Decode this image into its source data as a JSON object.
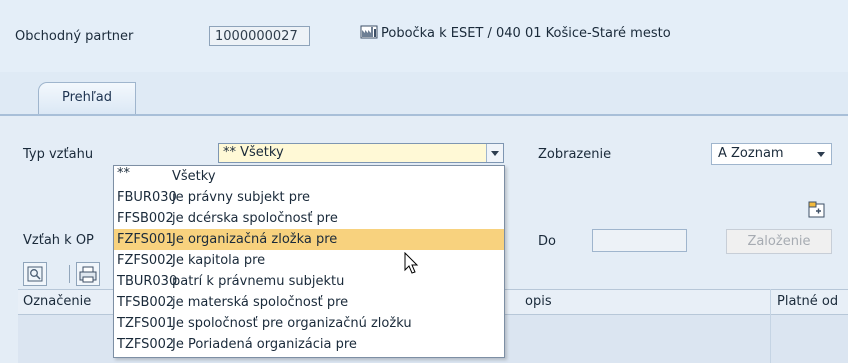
{
  "header": {
    "partner_label": "Obchodný partner",
    "partner_number": "1000000027",
    "branch_text": "Pobočka k ESET / 040 01 Košice-Staré mesto",
    "branch_icon": "building-icon"
  },
  "tabs": [
    {
      "label": "Prehľad"
    }
  ],
  "filters": {
    "relation_type_label": "Typ vzťahu",
    "relation_type_value": "** Všetky",
    "display_label": "Zobrazenie",
    "display_value": "A Zoznam",
    "relation_to_label": "Vzťah k OP",
    "to_label": "Do",
    "to_value": "",
    "create_button": "Založenie"
  },
  "dropdown": {
    "items": [
      {
        "code": "**",
        "text": "Všetky"
      },
      {
        "code": "FBUR030",
        "text": "je právny subjekt pre"
      },
      {
        "code": "FFSB002",
        "text": "je dcérska spoločnosť pre"
      },
      {
        "code": "FZFS001",
        "text": "Je organizačná zložka pre",
        "selected": true
      },
      {
        "code": "FZFS002",
        "text": "Je kapitola pre"
      },
      {
        "code": "TBUR030",
        "text": "patrí k právnemu subjektu"
      },
      {
        "code": "TFSB002",
        "text": "je materská spoločnosť pre"
      },
      {
        "code": "TZFS001",
        "text": "Je spoločnosť pre organizačnú zložku"
      },
      {
        "code": "TZFS002",
        "text": "Je Poriadená organizácia pre"
      }
    ]
  },
  "table": {
    "columns": [
      "Označenie",
      "opis",
      "Platné od"
    ]
  },
  "colors": {
    "selected_item": "#f8d27e",
    "combo_background": "#fff9d6",
    "panel": "#e4edf6"
  }
}
